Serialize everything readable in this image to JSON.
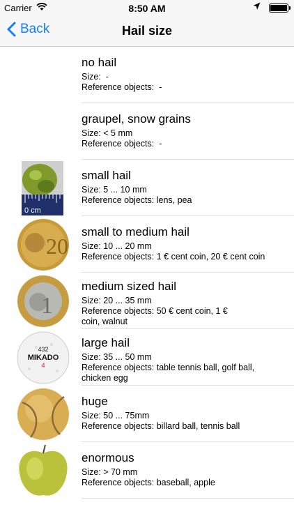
{
  "status_bar": {
    "carrier": "Carrier",
    "time": "8:50 AM"
  },
  "nav": {
    "back_label": "Back",
    "title": "Hail size"
  },
  "size_prefix": "Size:",
  "ref_prefix": "Reference objects:",
  "items": [
    {
      "name": "no hail",
      "size": "-",
      "refs": "-"
    },
    {
      "name": "graupel, snow grains",
      "size": "< 5 mm",
      "refs": "-"
    },
    {
      "name": "small hail",
      "size": "5 ... 10 mm",
      "refs": "lens, pea",
      "ruler_label": "0 cm"
    },
    {
      "name": "small to medium hail",
      "size": "10 ... 20 mm",
      "refs": "1 € cent coin, 20 € cent coin"
    },
    {
      "name": "medium sized hail",
      "size": "20 ... 35 mm",
      "refs": "50 € cent coin, 1 €\ncoin, walnut"
    },
    {
      "name": "large hail",
      "size": "35 ... 50 mm",
      "refs": "table tennis ball, golf ball,\nchicken egg",
      "ball_text_1": "432",
      "ball_text_2": "MIKADO",
      "ball_text_3": "4"
    },
    {
      "name": "huge",
      "size": "50 ... 75mm",
      "refs": "billard ball, tennis ball"
    },
    {
      "name": "enormous",
      "size": "> 70 mm",
      "refs": "baseball, apple"
    }
  ]
}
